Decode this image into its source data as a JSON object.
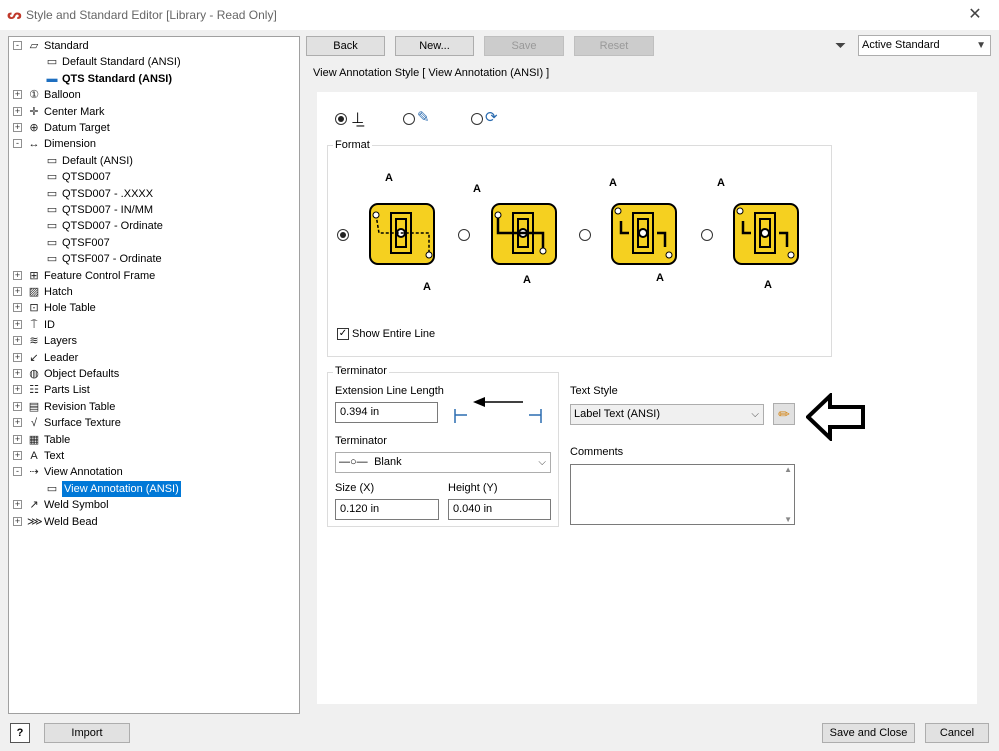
{
  "window": {
    "title": "Style and Standard Editor [Library - Read Only]"
  },
  "tree": [
    {
      "label": "Standard",
      "level": 0,
      "exp": "-",
      "icon": "standard-icon",
      "glyph": "▱"
    },
    {
      "label": "Default Standard (ANSI)",
      "level": 1,
      "icon": "style-icon",
      "glyph": "▭"
    },
    {
      "label": "QTS Standard (ANSI)",
      "level": 1,
      "icon": "active-style-icon",
      "glyph": "▬",
      "bold": true
    },
    {
      "label": "Balloon",
      "level": 0,
      "exp": "+",
      "icon": "balloon-icon",
      "glyph": "①"
    },
    {
      "label": "Center Mark",
      "level": 0,
      "exp": "+",
      "icon": "center-mark-icon",
      "glyph": "✛"
    },
    {
      "label": "Datum Target",
      "level": 0,
      "exp": "+",
      "icon": "datum-target-icon",
      "glyph": "⊕"
    },
    {
      "label": "Dimension",
      "level": 0,
      "exp": "-",
      "icon": "dimension-icon",
      "glyph": "↔"
    },
    {
      "label": "Default (ANSI)",
      "level": 1,
      "icon": "style-icon",
      "glyph": "▭"
    },
    {
      "label": "QTSD007",
      "level": 1,
      "icon": "style-icon",
      "glyph": "▭"
    },
    {
      "label": "QTSD007 - .XXXX",
      "level": 1,
      "icon": "style-icon",
      "glyph": "▭"
    },
    {
      "label": "QTSD007 - IN/MM",
      "level": 1,
      "icon": "style-icon",
      "glyph": "▭"
    },
    {
      "label": "QTSD007 - Ordinate",
      "level": 1,
      "icon": "style-icon",
      "glyph": "▭"
    },
    {
      "label": "QTSF007",
      "level": 1,
      "icon": "style-icon",
      "glyph": "▭"
    },
    {
      "label": "QTSF007 - Ordinate",
      "level": 1,
      "icon": "style-icon",
      "glyph": "▭"
    },
    {
      "label": "Feature Control Frame",
      "level": 0,
      "exp": "+",
      "icon": "feature-control-frame-icon",
      "glyph": "⊞"
    },
    {
      "label": "Hatch",
      "level": 0,
      "exp": "+",
      "icon": "hatch-icon",
      "glyph": "▨"
    },
    {
      "label": "Hole Table",
      "level": 0,
      "exp": "+",
      "icon": "hole-table-icon",
      "glyph": "⊡"
    },
    {
      "label": "ID",
      "level": 0,
      "exp": "+",
      "icon": "id-icon",
      "glyph": "⍑"
    },
    {
      "label": "Layers",
      "level": 0,
      "exp": "+",
      "icon": "layers-icon",
      "glyph": "≋"
    },
    {
      "label": "Leader",
      "level": 0,
      "exp": "+",
      "icon": "leader-icon",
      "glyph": "↙"
    },
    {
      "label": "Object Defaults",
      "level": 0,
      "exp": "+",
      "icon": "object-defaults-icon",
      "glyph": "◍"
    },
    {
      "label": "Parts List",
      "level": 0,
      "exp": "+",
      "icon": "parts-list-icon",
      "glyph": "☷"
    },
    {
      "label": "Revision Table",
      "level": 0,
      "exp": "+",
      "icon": "revision-table-icon",
      "glyph": "▤"
    },
    {
      "label": "Surface Texture",
      "level": 0,
      "exp": "+",
      "icon": "surface-texture-icon",
      "glyph": "√"
    },
    {
      "label": "Table",
      "level": 0,
      "exp": "+",
      "icon": "table-icon",
      "glyph": "▦"
    },
    {
      "label": "Text",
      "level": 0,
      "exp": "+",
      "icon": "text-icon",
      "glyph": "A"
    },
    {
      "label": "View Annotation",
      "level": 0,
      "exp": "-",
      "icon": "view-annotation-icon",
      "glyph": "⇢"
    },
    {
      "label": "View Annotation (ANSI)",
      "level": 1,
      "icon": "style-icon",
      "glyph": "▭",
      "selected": true
    },
    {
      "label": "Weld Symbol",
      "level": 0,
      "exp": "+",
      "icon": "weld-symbol-icon",
      "glyph": "↗"
    },
    {
      "label": "Weld Bead",
      "level": 0,
      "exp": "+",
      "icon": "weld-bead-icon",
      "glyph": "⋙"
    }
  ],
  "toolbar": {
    "back": "Back",
    "new": "New...",
    "save": "Save",
    "reset": "Reset"
  },
  "filter": {
    "value": "Active Standard"
  },
  "panel": {
    "heading": "View Annotation Style [ View Annotation (ANSI) ]",
    "format_label": "Format",
    "show_entire_line": "Show Entire Line",
    "plate_letter": "A",
    "terminator_group": "Terminator",
    "ext_line_label": "Extension Line Length",
    "ext_line_value": "0.394 in",
    "terminator_label": "Terminator",
    "terminator_value": "Blank",
    "size_label": "Size (X)",
    "size_value": "0.120 in",
    "height_label": "Height (Y)",
    "height_value": "0.040 in",
    "text_style_label": "Text Style",
    "text_style_value": "Label Text (ANSI)",
    "comments_label": "Comments"
  },
  "footer": {
    "import": "Import",
    "save_close": "Save and Close",
    "cancel": "Cancel",
    "help": "?"
  }
}
